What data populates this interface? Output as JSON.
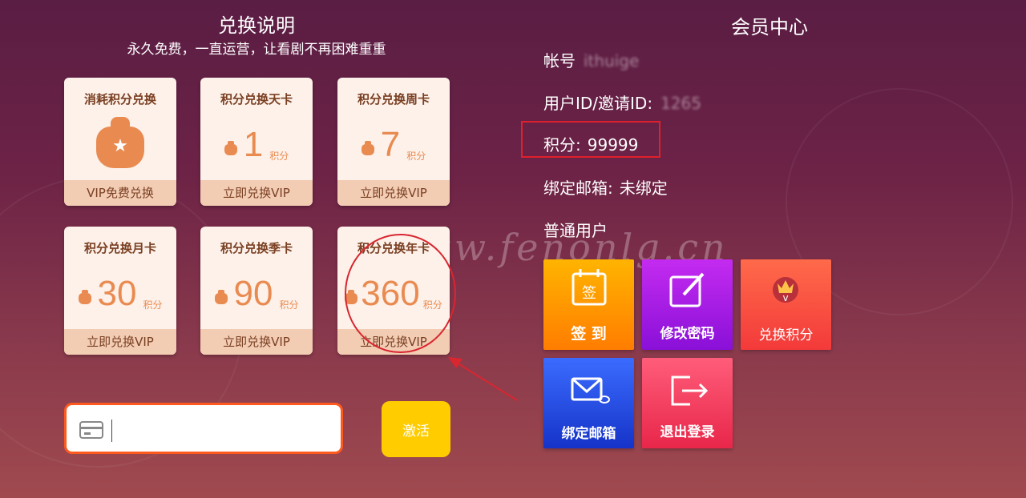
{
  "watermark": "www.fenonlg.cn",
  "left": {
    "title": "兑换说明",
    "subtitle": "永久免费，一直运营，让看剧不再困难重重",
    "cards": [
      {
        "title": "消耗积分兑换",
        "footer": "VIP免费兑换",
        "icon": "money-bag-star-icon"
      },
      {
        "title": "积分兑换天卡",
        "amount": "1",
        "unit": "积分",
        "footer": "立即兑换VIP"
      },
      {
        "title": "积分兑换周卡",
        "amount": "7",
        "unit": "积分",
        "footer": "立即兑换VIP"
      },
      {
        "title": "积分兑换月卡",
        "amount": "30",
        "unit": "积分",
        "footer": "立即兑换VIP"
      },
      {
        "title": "积分兑换季卡",
        "amount": "90",
        "unit": "积分",
        "footer": "立即兑换VIP"
      },
      {
        "title": "积分兑换年卡",
        "amount": "360",
        "unit": "积分",
        "footer": "立即兑换VIP"
      }
    ],
    "code_input": {
      "value": "",
      "placeholder": ""
    },
    "activate_label": "激活"
  },
  "right": {
    "title": "会员中心",
    "account_label": "帐号",
    "account_value": "ithuige",
    "user_id_label": "用户ID/邀请ID:",
    "user_id_value": "1265",
    "points_label": "积分:",
    "points_value": "99999",
    "email_label": "绑定邮箱:",
    "email_value": "未绑定",
    "user_type": "普通用户",
    "tiles": [
      {
        "label": "签 到",
        "icon": "calendar-sign-icon",
        "color_top": "#ffb400",
        "color_bottom": "#ff7d00"
      },
      {
        "label": "修改密码",
        "icon": "edit-icon",
        "color_top": "#c42bf0",
        "color_bottom": "#8a10d8"
      },
      {
        "label": "兑换积分",
        "icon": "crown-v-icon",
        "color_top": "#ff6a4a",
        "color_bottom": "#f33a3a"
      },
      {
        "label": "绑定邮箱",
        "icon": "mail-link-icon",
        "color_top": "#3b6cff",
        "color_bottom": "#1633c8"
      },
      {
        "label": "退出登录",
        "icon": "logout-icon",
        "color_top": "#ff5d7a",
        "color_bottom": "#e8264a"
      }
    ]
  },
  "colors": {
    "card_bg": "#fdf1ea",
    "card_footer": "#f2ccb3",
    "accent_orange": "#e98b51",
    "highlight_red": "#e0202a",
    "activate_yellow": "#ffcc00"
  }
}
